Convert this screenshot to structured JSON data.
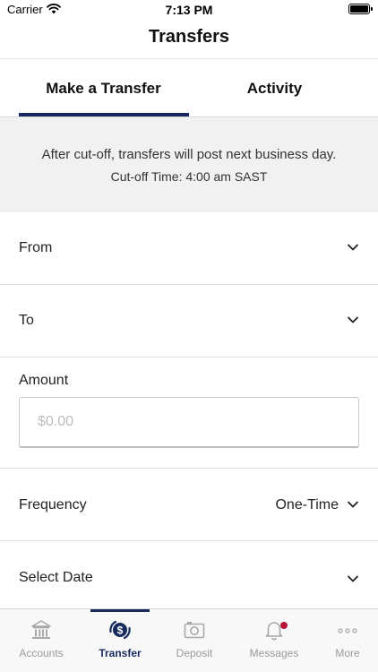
{
  "status_bar": {
    "carrier": "Carrier",
    "time": "7:13 PM"
  },
  "nav": {
    "title": "Transfers"
  },
  "tabs": [
    {
      "label": "Make a Transfer",
      "active": true
    },
    {
      "label": "Activity",
      "active": false
    }
  ],
  "notice": {
    "message": "After cut-off, transfers will post next business day.",
    "cutoff": "Cut-off Time: 4:00 am SAST"
  },
  "form": {
    "from_label": "From",
    "to_label": "To",
    "amount_label": "Amount",
    "amount_placeholder": "$0.00",
    "amount_value": "",
    "frequency_label": "Frequency",
    "frequency_value": "One-Time",
    "date_label": "Select Date"
  },
  "tabbar": {
    "items": [
      {
        "label": "Accounts",
        "icon": "bank-icon"
      },
      {
        "label": "Transfer",
        "icon": "transfer-icon",
        "active": true
      },
      {
        "label": "Deposit",
        "icon": "camera-icon"
      },
      {
        "label": "Messages",
        "icon": "bell-icon",
        "badge": true
      },
      {
        "label": "More",
        "icon": "more-icon"
      }
    ]
  },
  "colors": {
    "accent": "#172a5e",
    "badge": "#b5163a",
    "notice_bg": "#f1f1f1",
    "inactive": "#9a9a9a"
  }
}
